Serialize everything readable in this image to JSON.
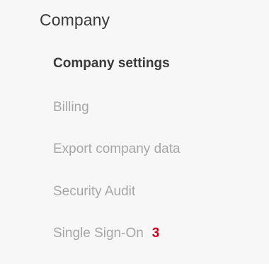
{
  "section": {
    "title": "Company"
  },
  "items": [
    {
      "label": "Company settings",
      "active": true
    },
    {
      "label": "Billing",
      "active": false
    },
    {
      "label": "Export company data",
      "active": false
    },
    {
      "label": "Security Audit",
      "active": false
    },
    {
      "label": "Single Sign-On",
      "active": false,
      "badge": "3"
    }
  ],
  "colors": {
    "background": "#f7f7f7",
    "active_text": "#3a3a3a",
    "inactive_text": "#a7a7a7",
    "badge": "#d0021b"
  }
}
